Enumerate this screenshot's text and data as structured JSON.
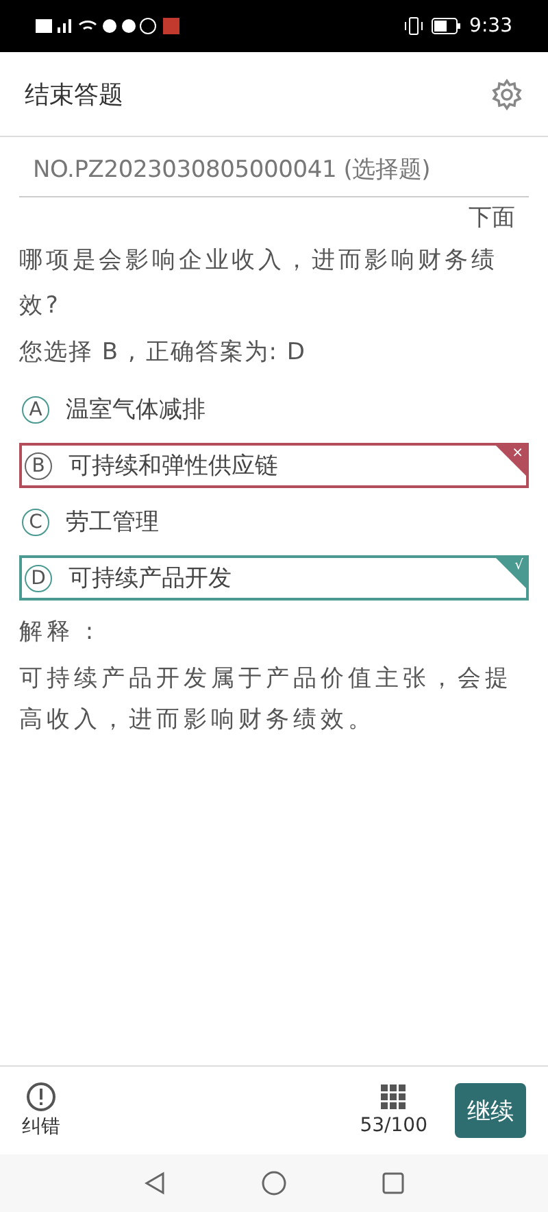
{
  "status_bar": {
    "time": "9:33"
  },
  "header": {
    "title": "结束答题"
  },
  "question": {
    "number": "NO.PZ2023030805000041 (选择题)",
    "lead": "下面",
    "text": "哪项是会影响企业收入，进而影响财务绩效?",
    "result": "您选择 B , 正确答案为: D"
  },
  "options": [
    {
      "letter": "A",
      "text": "温室气体减排",
      "kind": "plain"
    },
    {
      "letter": "B",
      "text": "可持续和弹性供应链",
      "kind": "wrong",
      "mark": "×"
    },
    {
      "letter": "C",
      "text": "劳工管理",
      "kind": "plain"
    },
    {
      "letter": "D",
      "text": "可持续产品开发",
      "kind": "correct",
      "mark": "√"
    }
  ],
  "explanation": {
    "label": "解释 :",
    "text": "可持续产品开发属于产品价值主张，会提高收入，进而影响财务绩效。"
  },
  "bottom_bar": {
    "report_label": "纠错",
    "progress": "53/100",
    "continue_label": "继续"
  }
}
